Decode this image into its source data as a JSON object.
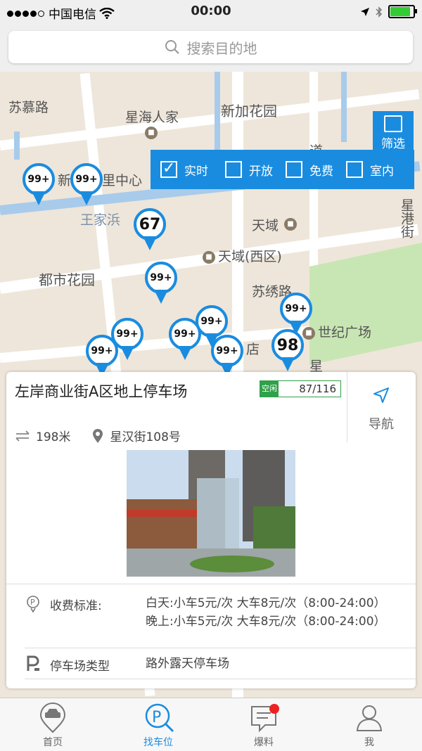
{
  "status_bar": {
    "carrier": "中国电信",
    "time": "00:00"
  },
  "search": {
    "placeholder": "搜索目的地"
  },
  "filter": {
    "button_label": "筛选",
    "options": [
      {
        "label": "实时",
        "checked": true
      },
      {
        "label": "开放",
        "checked": false
      },
      {
        "label": "免费",
        "checked": false
      },
      {
        "label": "室内",
        "checked": false
      }
    ]
  },
  "map": {
    "labels": {
      "l1": "苏慕路",
      "l2": "星海人家",
      "l3": "新加花园",
      "l4": "新",
      "l5": "里中心",
      "l6": "王家浜",
      "l7": "天域",
      "l8": "天域(西区)",
      "l9": "都市花园",
      "l10": "苏绣路",
      "l11": "世纪广场",
      "l12": "星港街",
      "l13": "店",
      "l14": "星",
      "l15": "道"
    },
    "pins": {
      "p1": "99+",
      "p2": "99+",
      "p3": "67",
      "p4": "99+",
      "p5": "99+",
      "p6": "99+",
      "p7": "99+",
      "p8": "99+",
      "p9": "99+",
      "p10": "98",
      "p11": "99+"
    },
    "colors": {
      "pin": "#1a8ce0",
      "water": "#a8cbeb"
    }
  },
  "card": {
    "name": "左岸商业街A区地上停车场",
    "status_tag": "空闲",
    "availability": "87/116",
    "navigate_label": "导航",
    "distance": "198米",
    "address": "星汉街108号",
    "fee_label": "收费标准:",
    "fee_value": "白天:小车5元/次 大车8元/次（8:00-24:00） 晚上:小车5元/次 大车8元/次（8:00-24:00）",
    "type_label": "停车场类型",
    "type_value": "路外露天停车场"
  },
  "tabs": [
    {
      "label": "首页",
      "icon": "car-icon"
    },
    {
      "label": "找车位",
      "icon": "parking-search-icon",
      "active": true
    },
    {
      "label": "爆料",
      "icon": "message-icon",
      "badge": true
    },
    {
      "label": "我",
      "icon": "person-icon"
    }
  ]
}
